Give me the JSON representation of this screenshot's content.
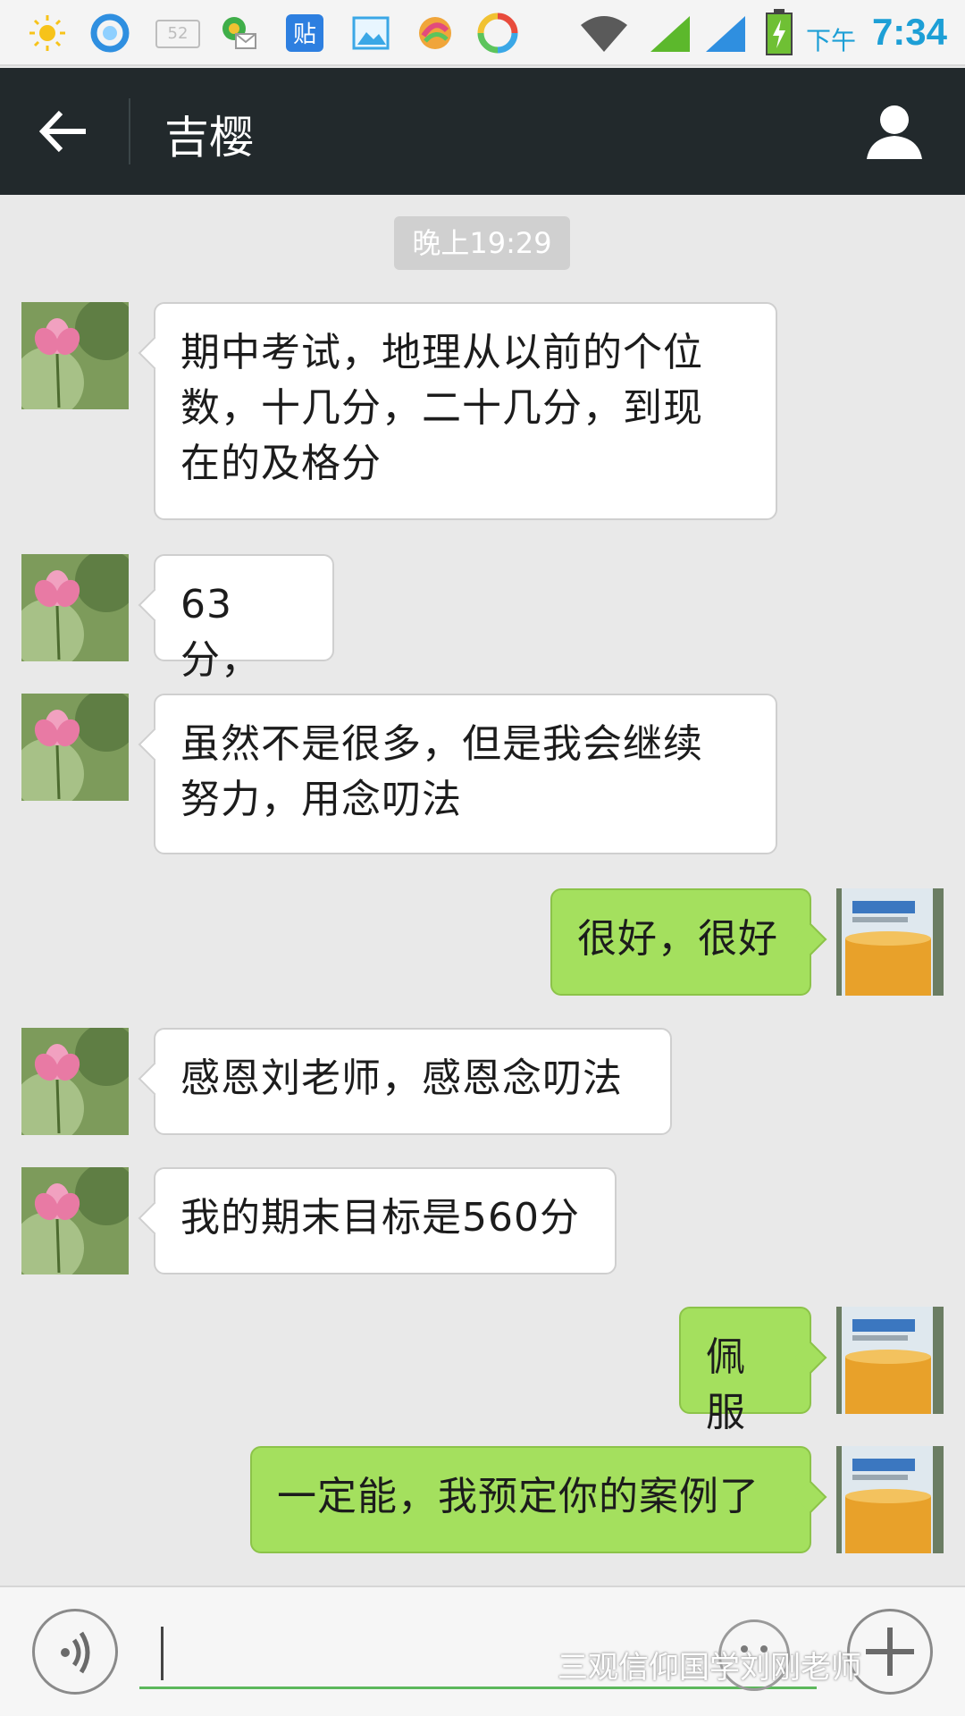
{
  "status_bar": {
    "ampm": "下午",
    "time": "7:34",
    "notif_badge": "52",
    "icons": [
      "sun-icon",
      "browser-icon",
      "notification-52-icon",
      "mail-icon",
      "tieba-icon",
      "gallery-icon",
      "app-icon",
      "sync-icon",
      "wifi-icon",
      "signal-icon",
      "signal-icon",
      "battery-charging-icon"
    ]
  },
  "header": {
    "title": "吉樱",
    "back_icon": "arrow-left-icon",
    "profile_icon": "person-icon"
  },
  "chat": {
    "timestamp": "晚上19:29",
    "messages": [
      {
        "side": "in",
        "lines": [
          "期中考试，地理从以前的个位",
          "数，十几分，二十几分，到现",
          "在的及格分"
        ]
      },
      {
        "side": "in",
        "lines": [
          "63分，"
        ]
      },
      {
        "side": "in",
        "lines": [
          "虽然不是很多，但是我会继续",
          "努力，用念叨法"
        ]
      },
      {
        "side": "out",
        "lines": [
          "很好，很好"
        ]
      },
      {
        "side": "in",
        "lines": [
          "感恩刘老师，感恩念叨法"
        ]
      },
      {
        "side": "in",
        "lines": [
          "我的期末目标是560分"
        ]
      },
      {
        "side": "out",
        "lines": [
          "佩服"
        ]
      },
      {
        "side": "out",
        "lines": [
          "一定能，我预定你的案例了"
        ]
      }
    ]
  },
  "input_bar": {
    "voice_icon": "voice-icon",
    "emoji_icon": "emoji-icon",
    "plus_icon": "plus-icon",
    "watermark": "三观信仰国学刘刚老师"
  },
  "colors": {
    "header_bg": "#22292c",
    "chat_bg": "#e9e9e9",
    "bubble_out": "#a4e05e",
    "bubble_in": "#ffffff",
    "accent": "#1d9fd6"
  }
}
